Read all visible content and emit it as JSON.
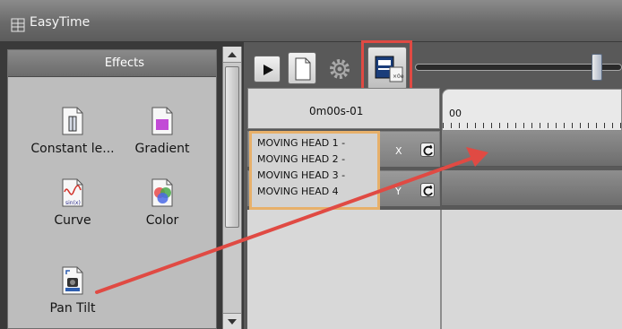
{
  "window": {
    "title": "EasyTime",
    "app_icon": "grid-icon"
  },
  "effects": {
    "header": "Effects",
    "items": [
      {
        "label": "Constant le...",
        "icon": "constant-level-icon"
      },
      {
        "label": "Gradient",
        "icon": "gradient-icon"
      },
      {
        "label": "Curve",
        "icon": "curve-icon"
      },
      {
        "label": "Color",
        "icon": "color-icon"
      },
      {
        "label": "Pan Tilt",
        "icon": "pan-tilt-icon"
      }
    ]
  },
  "toolbar": {
    "play_icon": "play-icon",
    "new_icon": "document-icon",
    "settings_icon": "gear-icon",
    "highlighted_icon": "timing-icon",
    "highlight_color": "#e04a43"
  },
  "timeline": {
    "current_time": "0m00s-01",
    "ruler_start": "00",
    "zoom": 0.86
  },
  "tracks": [
    {
      "axis": "X"
    },
    {
      "axis": "Y"
    }
  ],
  "group": {
    "border_color": "#e7b06a",
    "lines": [
      "MOVING HEAD  1 -",
      "MOVING HEAD  2 -",
      "MOVING HEAD  3 -",
      "MOVING HEAD  4"
    ]
  },
  "annotation": {
    "arrow_color": "#e04a43"
  }
}
